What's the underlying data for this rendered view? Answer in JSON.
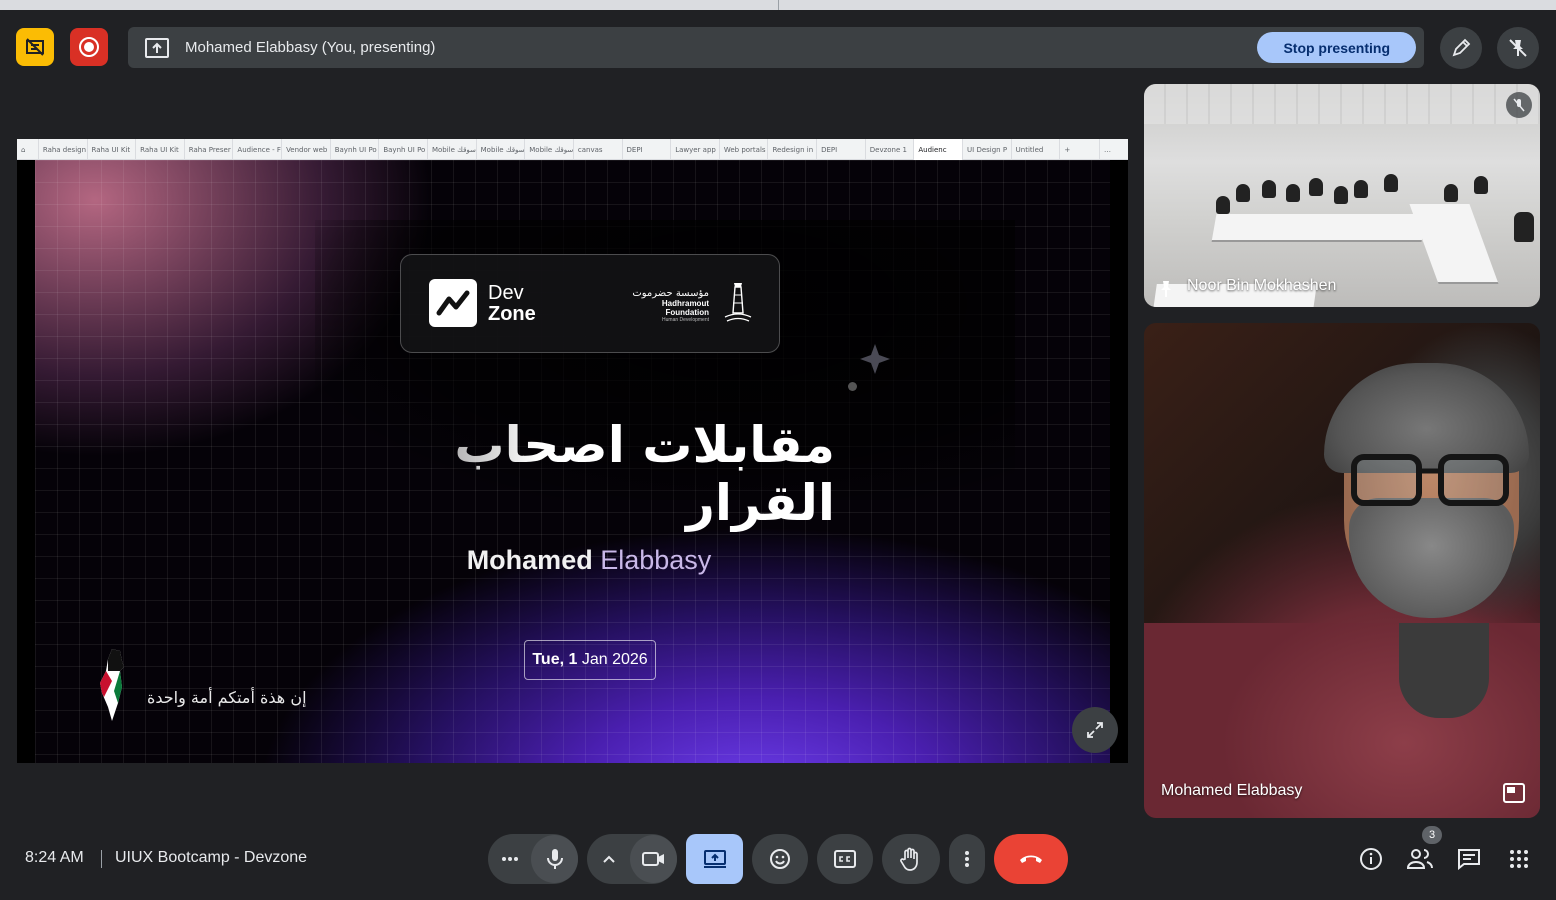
{
  "top_bar": {
    "presenting_text": "Mohamed Elabbasy (You, presenting)",
    "stop_label": "Stop presenting"
  },
  "browser_tabs": [
    "Raha design",
    "Raha UI Kit",
    "Raha UI Kit",
    "Raha Preser",
    "Audience - F",
    "Vendor web",
    "Baynh UI Po",
    "Baynh UI Po",
    "Mobile سوقك",
    "Mobile سوقك",
    "Mobile سوقك",
    "canvas",
    "DEPI",
    "Lawyer app",
    "Web portals",
    "Redesign in",
    "DEPI",
    "Devzone 1",
    "Audienc",
    "UI Design P",
    "Untitled",
    "+",
    "…"
  ],
  "slide": {
    "brand_dev": "Dev",
    "brand_zone": "Zone",
    "foundation_ar": "مؤسسة حضرموت",
    "foundation_en": "Hadhramout Foundation",
    "foundation_sub": "Human Development",
    "title_ar": "مقابلات اصحاب القرار",
    "presenter_first": "Mohamed",
    "presenter_last": "Elabbasy",
    "date_day": "Tue, 1",
    "date_rest": "Jan 2026",
    "quote_ar": "إن هذة أمتكم أمة واحدة"
  },
  "tiles": [
    {
      "name": "Noor Bin Mokhashen"
    },
    {
      "name": "Mohamed Elabbasy"
    }
  ],
  "bottom_bar": {
    "time": "8:24 AM",
    "meeting_name": "UIUX Bootcamp - Devzone",
    "participants_count": "3"
  },
  "colors": {
    "accent_blue": "#a8c7fa",
    "end_call_red": "#ea4335",
    "record_red": "#d93025",
    "yellow": "#fbbc04",
    "bar_bg": "#3c4043"
  }
}
